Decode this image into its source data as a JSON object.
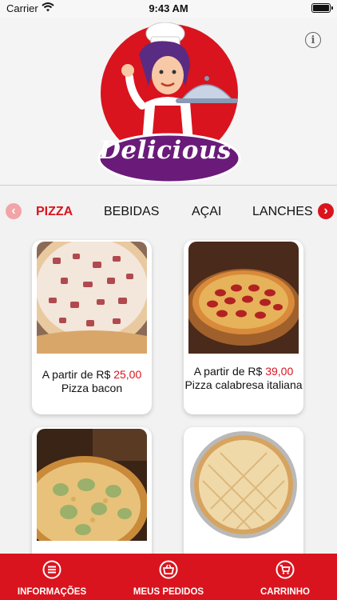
{
  "status_bar": {
    "carrier": "Carrier",
    "time": "9:43 AM"
  },
  "brand": {
    "logo_text": "Delicious",
    "accent_color": "#d9141e",
    "logo_purple": "#6a1b7a"
  },
  "categories": {
    "items": [
      "PIZZA",
      "BEBIDAS",
      "AÇAI",
      "LANCHES"
    ],
    "active": "PIZZA"
  },
  "products": [
    {
      "prefix": "A partir de R$ ",
      "price": "25,00",
      "name": "Pizza bacon"
    },
    {
      "prefix": "A partir de R$ ",
      "price": "39,00",
      "name": "Pizza calabresa italiana"
    }
  ],
  "bottom_nav": {
    "info": "INFORMAÇÕES",
    "orders": "MEUS PEDIDOS",
    "cart": "CARRINHO"
  },
  "icons": {
    "info": "info-icon",
    "prev": "chevron-left-icon",
    "next": "chevron-right-icon",
    "menu": "menu-icon",
    "orders": "basket-icon",
    "cart": "cart-icon"
  }
}
